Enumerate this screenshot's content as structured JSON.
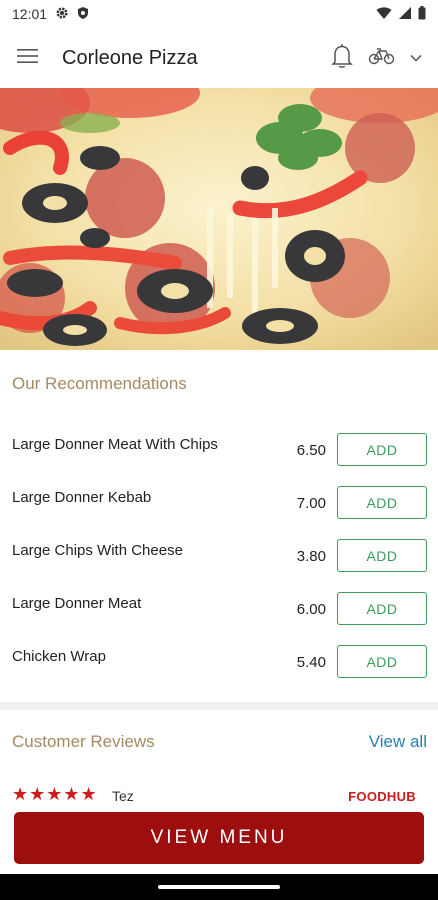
{
  "status_bar": {
    "time": "12:01",
    "icons": [
      "gear-icon",
      "shield-icon",
      "wifi-icon",
      "signal-icon",
      "battery-icon"
    ]
  },
  "app_bar": {
    "title": "Corleone Pizza",
    "icons": [
      "menu-icon",
      "bell-icon",
      "bicycle-icon",
      "chevron-down-icon"
    ]
  },
  "hero": {
    "image": "pizza-photo"
  },
  "recommendations": {
    "title": "Our Recommendations",
    "add_label": "ADD",
    "items": [
      {
        "name": "Large Donner Meat With Chips",
        "price": "6.50"
      },
      {
        "name": "Large Donner Kebab",
        "price": "7.00"
      },
      {
        "name": "Large Chips With Cheese",
        "price": "3.80"
      },
      {
        "name": "Large Donner Meat",
        "price": "6.00"
      },
      {
        "name": "Chicken Wrap",
        "price": "5.40"
      }
    ]
  },
  "reviews": {
    "title": "Customer Reviews",
    "view_all": "View all",
    "first_review": {
      "stars": "★★★★★",
      "rating": 5,
      "reviewer": "Tez",
      "source": "FOODHUB"
    }
  },
  "view_menu_button": "VIEW MENU",
  "colors": {
    "accent_gold": "#a68a60",
    "add_green": "#3c9c5a",
    "link_blue": "#2a7fb0",
    "brand_red": "#9d0e0e",
    "star_red": "#d01c1c"
  }
}
